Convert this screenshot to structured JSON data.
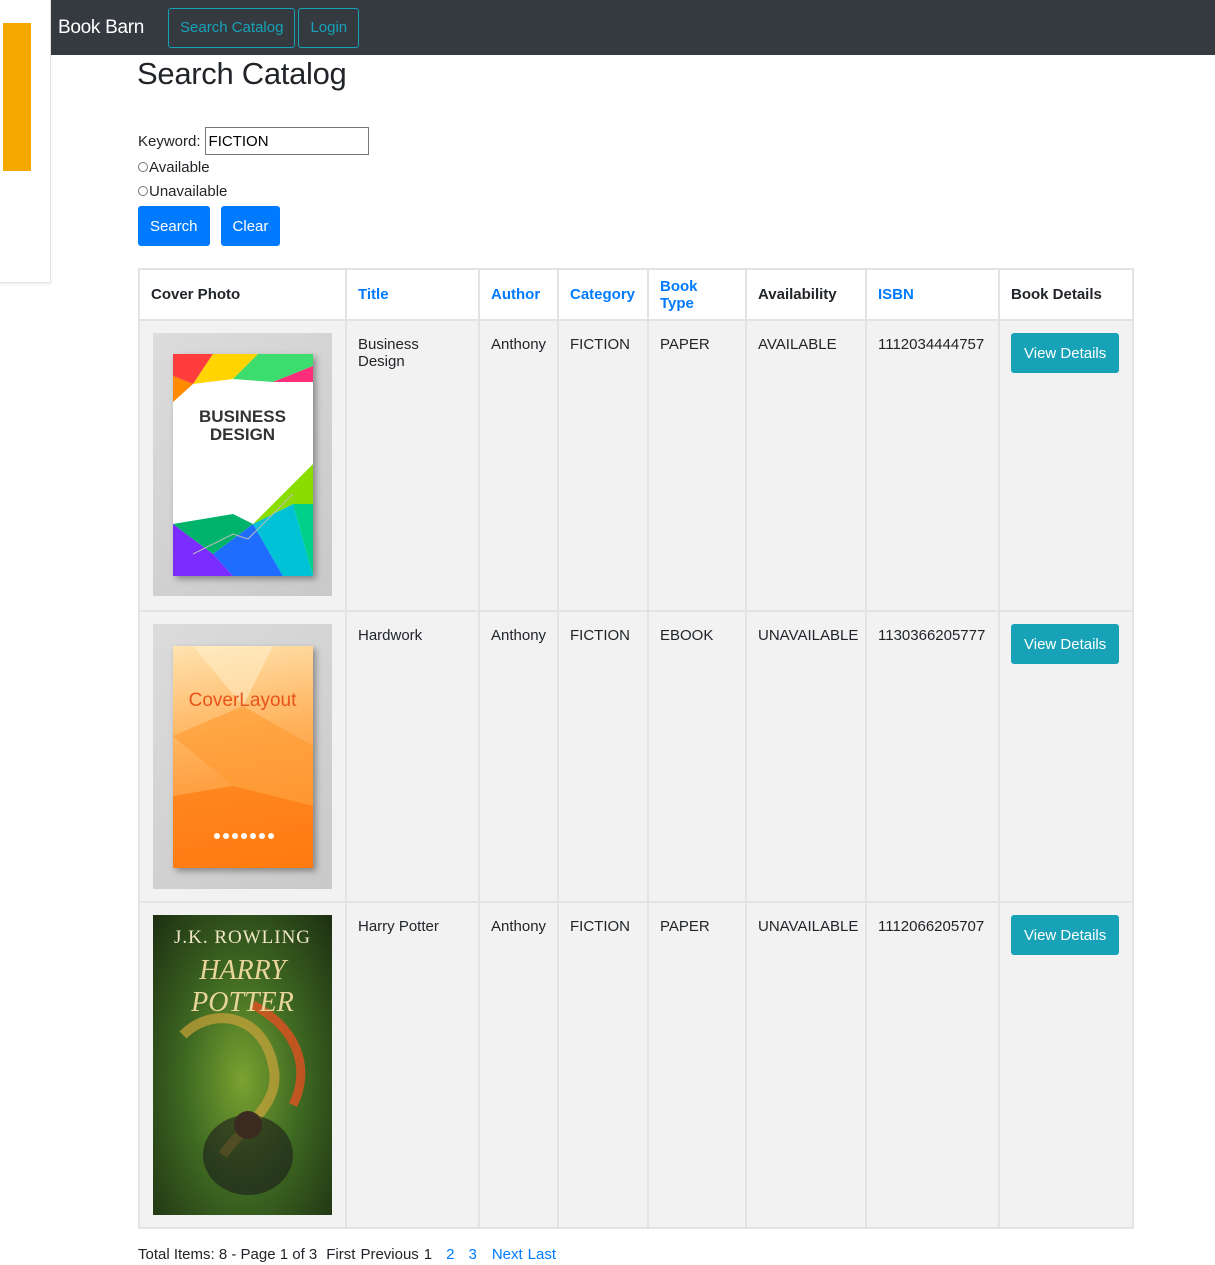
{
  "navbar": {
    "brand": "Book Barn",
    "search_catalog": "Search Catalog",
    "login": "Login"
  },
  "page_title": "Search Catalog",
  "form": {
    "keyword_label": "Keyword:",
    "keyword_value": "FICTION",
    "available_label": "Available",
    "unavailable_label": "Unavailable",
    "search_button": "Search",
    "clear_button": "Clear"
  },
  "table": {
    "headers": {
      "cover_photo": "Cover Photo",
      "title": "Title",
      "author": "Author",
      "category": "Category",
      "book_type": "Book Type",
      "availability": "Availability",
      "isbn": "ISBN",
      "book_details": "Book Details"
    },
    "view_details_label": "View Details",
    "rows": [
      {
        "title": "Business Design",
        "author": "Anthony",
        "category": "FICTION",
        "book_type": "PAPER",
        "availability": "AVAILABLE",
        "isbn": "1112034444757",
        "cover_text": "BUSINESS DESIGN"
      },
      {
        "title": "Hardwork",
        "author": "Anthony",
        "category": "FICTION",
        "book_type": "EBOOK",
        "availability": "UNAVAILABLE",
        "isbn": "1130366205777",
        "cover_text": "CoverLayout"
      },
      {
        "title": "Harry Potter",
        "author": "Anthony",
        "category": "FICTION",
        "book_type": "PAPER",
        "availability": "UNAVAILABLE",
        "isbn": "1112066205707",
        "cover_author": "J.K. ROWLING",
        "cover_text": "HARRY POTTER"
      }
    ]
  },
  "pagination": {
    "summary": "Total Items: 8 - Page 1 of 3",
    "first": "First",
    "previous": "Previous",
    "current": "1",
    "page2": "2",
    "page3": "3",
    "next": "Next",
    "last": "Last"
  },
  "colors": {
    "navbar_bg": "#343a40",
    "nav_outline": "#17a2b8",
    "primary": "#007bff",
    "info": "#17a2b8",
    "accent": "#f5a800",
    "row_bg": "#f2f2f2"
  }
}
